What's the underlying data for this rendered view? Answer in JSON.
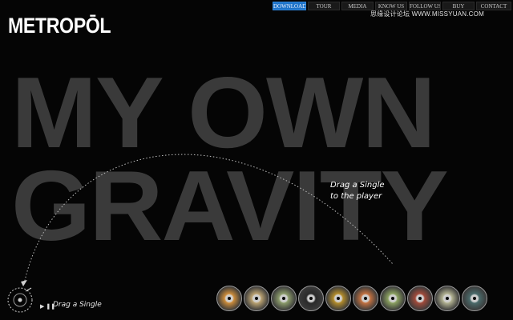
{
  "brand": {
    "logo": "METROPŌL"
  },
  "nav": [
    {
      "label": "DOWNLOAD",
      "active": true,
      "width": 42
    },
    {
      "label": "TOUR",
      "active": false,
      "width": 40
    },
    {
      "label": "MEDIA",
      "active": false,
      "width": 40
    },
    {
      "label": "KNOW US",
      "active": false,
      "width": 40
    },
    {
      "label": "FOLLOW US",
      "active": false,
      "width": 40
    },
    {
      "label": "BUY",
      "active": false,
      "width": 40
    },
    {
      "label": "CONTACT",
      "active": false,
      "width": 44
    }
  ],
  "watermark": "思缘设计论坛 WWW.MISSYUAN.COM",
  "hero": {
    "line1": "MY OWN",
    "line2": "GRAVITY"
  },
  "hint": {
    "line1": "Drag a Single",
    "line2": "to the player"
  },
  "player": {
    "controls": "▶ ❚❚",
    "label": "Drag a Single"
  },
  "colors": {
    "accent": "#1e73c8",
    "hero_text": "#3a3a3a",
    "background": "#050505"
  },
  "singles": [
    {
      "name": "single-1",
      "color": "#c98a3a"
    },
    {
      "name": "single-2",
      "color": "#b8a070"
    },
    {
      "name": "single-3",
      "color": "#8a9a6a"
    },
    {
      "name": "single-4",
      "color": "#2a2a2a"
    },
    {
      "name": "single-5",
      "color": "#b08a2a"
    },
    {
      "name": "single-6",
      "color": "#c07040"
    },
    {
      "name": "single-7",
      "color": "#8aa060"
    },
    {
      "name": "single-8",
      "color": "#a04a3a"
    },
    {
      "name": "single-9",
      "color": "#b0b090"
    },
    {
      "name": "single-10",
      "color": "#4a6a6a"
    }
  ]
}
